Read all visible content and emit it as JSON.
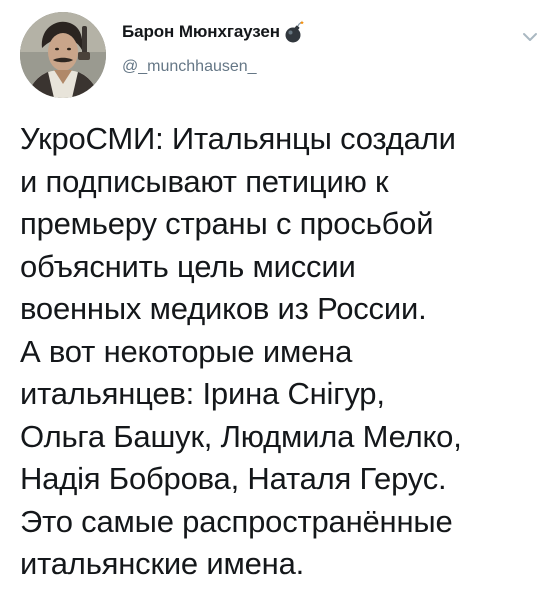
{
  "tweet": {
    "author": {
      "display_name": "Барон Мюнхгаузен",
      "handle": "@_munchhausen_"
    },
    "text": "УкроСМИ: Итальянцы создали\nи подписывают петицию к\nпремьеру страны с просьбой\nобъяснить цель миссии\nвоенных медиков из России.\nА вот некоторые имена\nитальянцев: Ірина Снігур,\nОльга Башук, Людмила Мелко,\nНадія Боброва, Наталя Герус.\nЭто самые распространённые\nитальянские имена."
  },
  "icons": {
    "avatar": "avatar-portrait",
    "name_emoji": "bomb-icon",
    "menu": "chevron-down-icon"
  },
  "colors": {
    "text_primary": "#14171a",
    "text_secondary": "#657786",
    "background": "#ffffff",
    "chevron": "#aab8c2"
  }
}
